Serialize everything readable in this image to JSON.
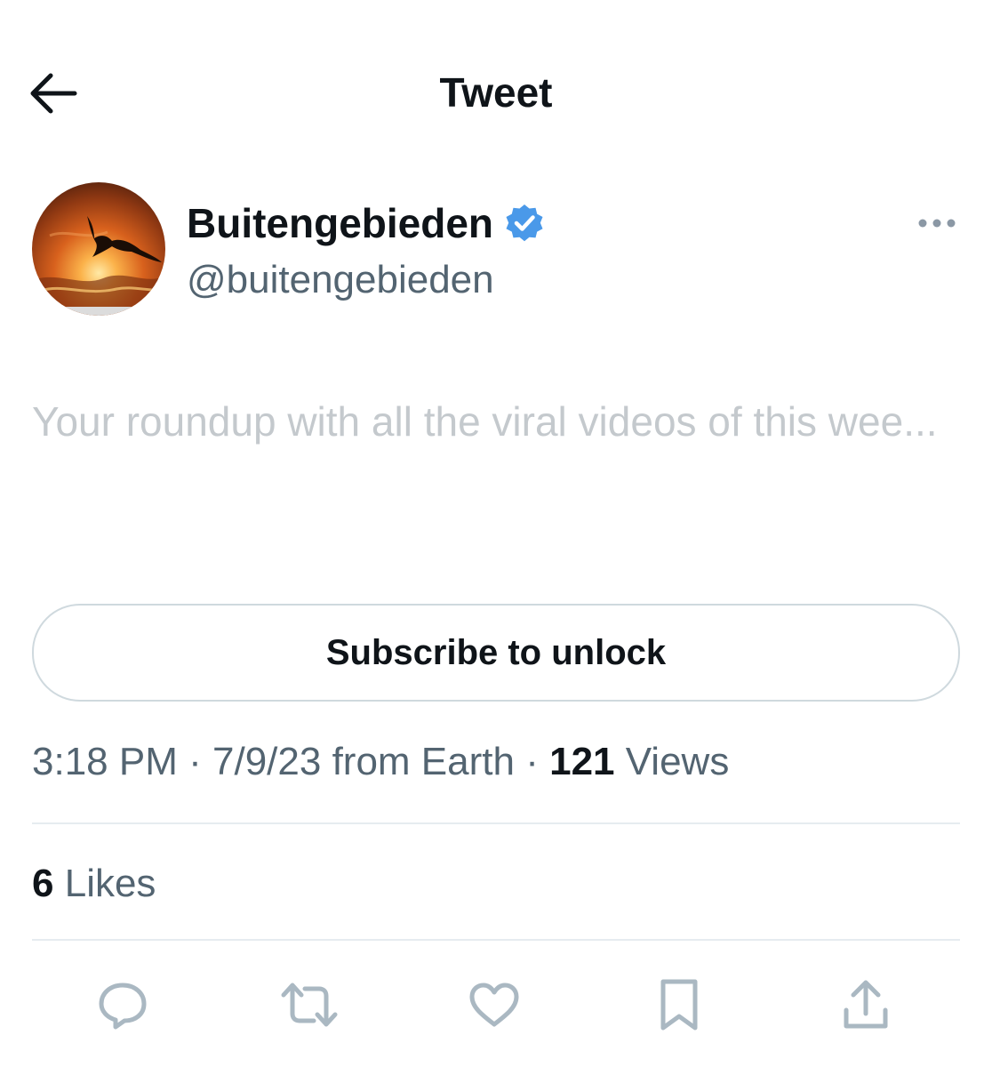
{
  "header": {
    "title": "Tweet",
    "back_icon": "arrow-left-icon"
  },
  "author": {
    "display_name": "Buitengebieden",
    "handle": "@buitengebieden",
    "verified": true,
    "verified_color": "#4a99e9",
    "avatar": "sunset-bird-avatar"
  },
  "tweet": {
    "text": "Your roundup with all the viral videos of this wee...",
    "text_color": "#c4c9cd"
  },
  "subscribe": {
    "label": "Subscribe to unlock"
  },
  "meta": {
    "time": "3:18 PM",
    "separator": "·",
    "date": "7/9/23",
    "source": "from Earth",
    "views_count": "121",
    "views_label": "Views"
  },
  "engagement": {
    "likes_count": "6",
    "likes_label": "Likes"
  },
  "actions": [
    {
      "name": "reply",
      "icon": "reply-icon"
    },
    {
      "name": "retweet",
      "icon": "retweet-icon"
    },
    {
      "name": "like",
      "icon": "heart-icon"
    },
    {
      "name": "bookmark",
      "icon": "bookmark-icon"
    },
    {
      "name": "share",
      "icon": "share-icon"
    }
  ],
  "colors": {
    "primary_text": "#0f1419",
    "secondary_text": "#536471",
    "border": "#cfd9de",
    "divider": "#e6ecf0",
    "action_icon": "#aab8c2"
  }
}
